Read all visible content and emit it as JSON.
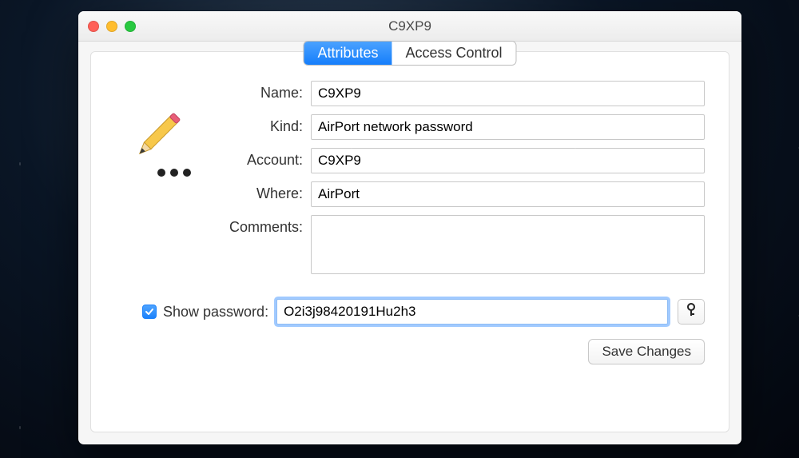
{
  "window": {
    "title": "C9XP9"
  },
  "tabs": {
    "attributes": "Attributes",
    "access_control": "Access Control"
  },
  "labels": {
    "name": "Name:",
    "kind": "Kind:",
    "account": "Account:",
    "where": "Where:",
    "comments": "Comments:",
    "show_password": "Show password:"
  },
  "values": {
    "name": "C9XP9",
    "kind": "AirPort network password",
    "account": "C9XP9",
    "where": "AirPort",
    "comments": "",
    "password": "O2i3j98420191Hu2h3"
  },
  "buttons": {
    "save": "Save Changes"
  },
  "state": {
    "show_password_checked": true
  }
}
